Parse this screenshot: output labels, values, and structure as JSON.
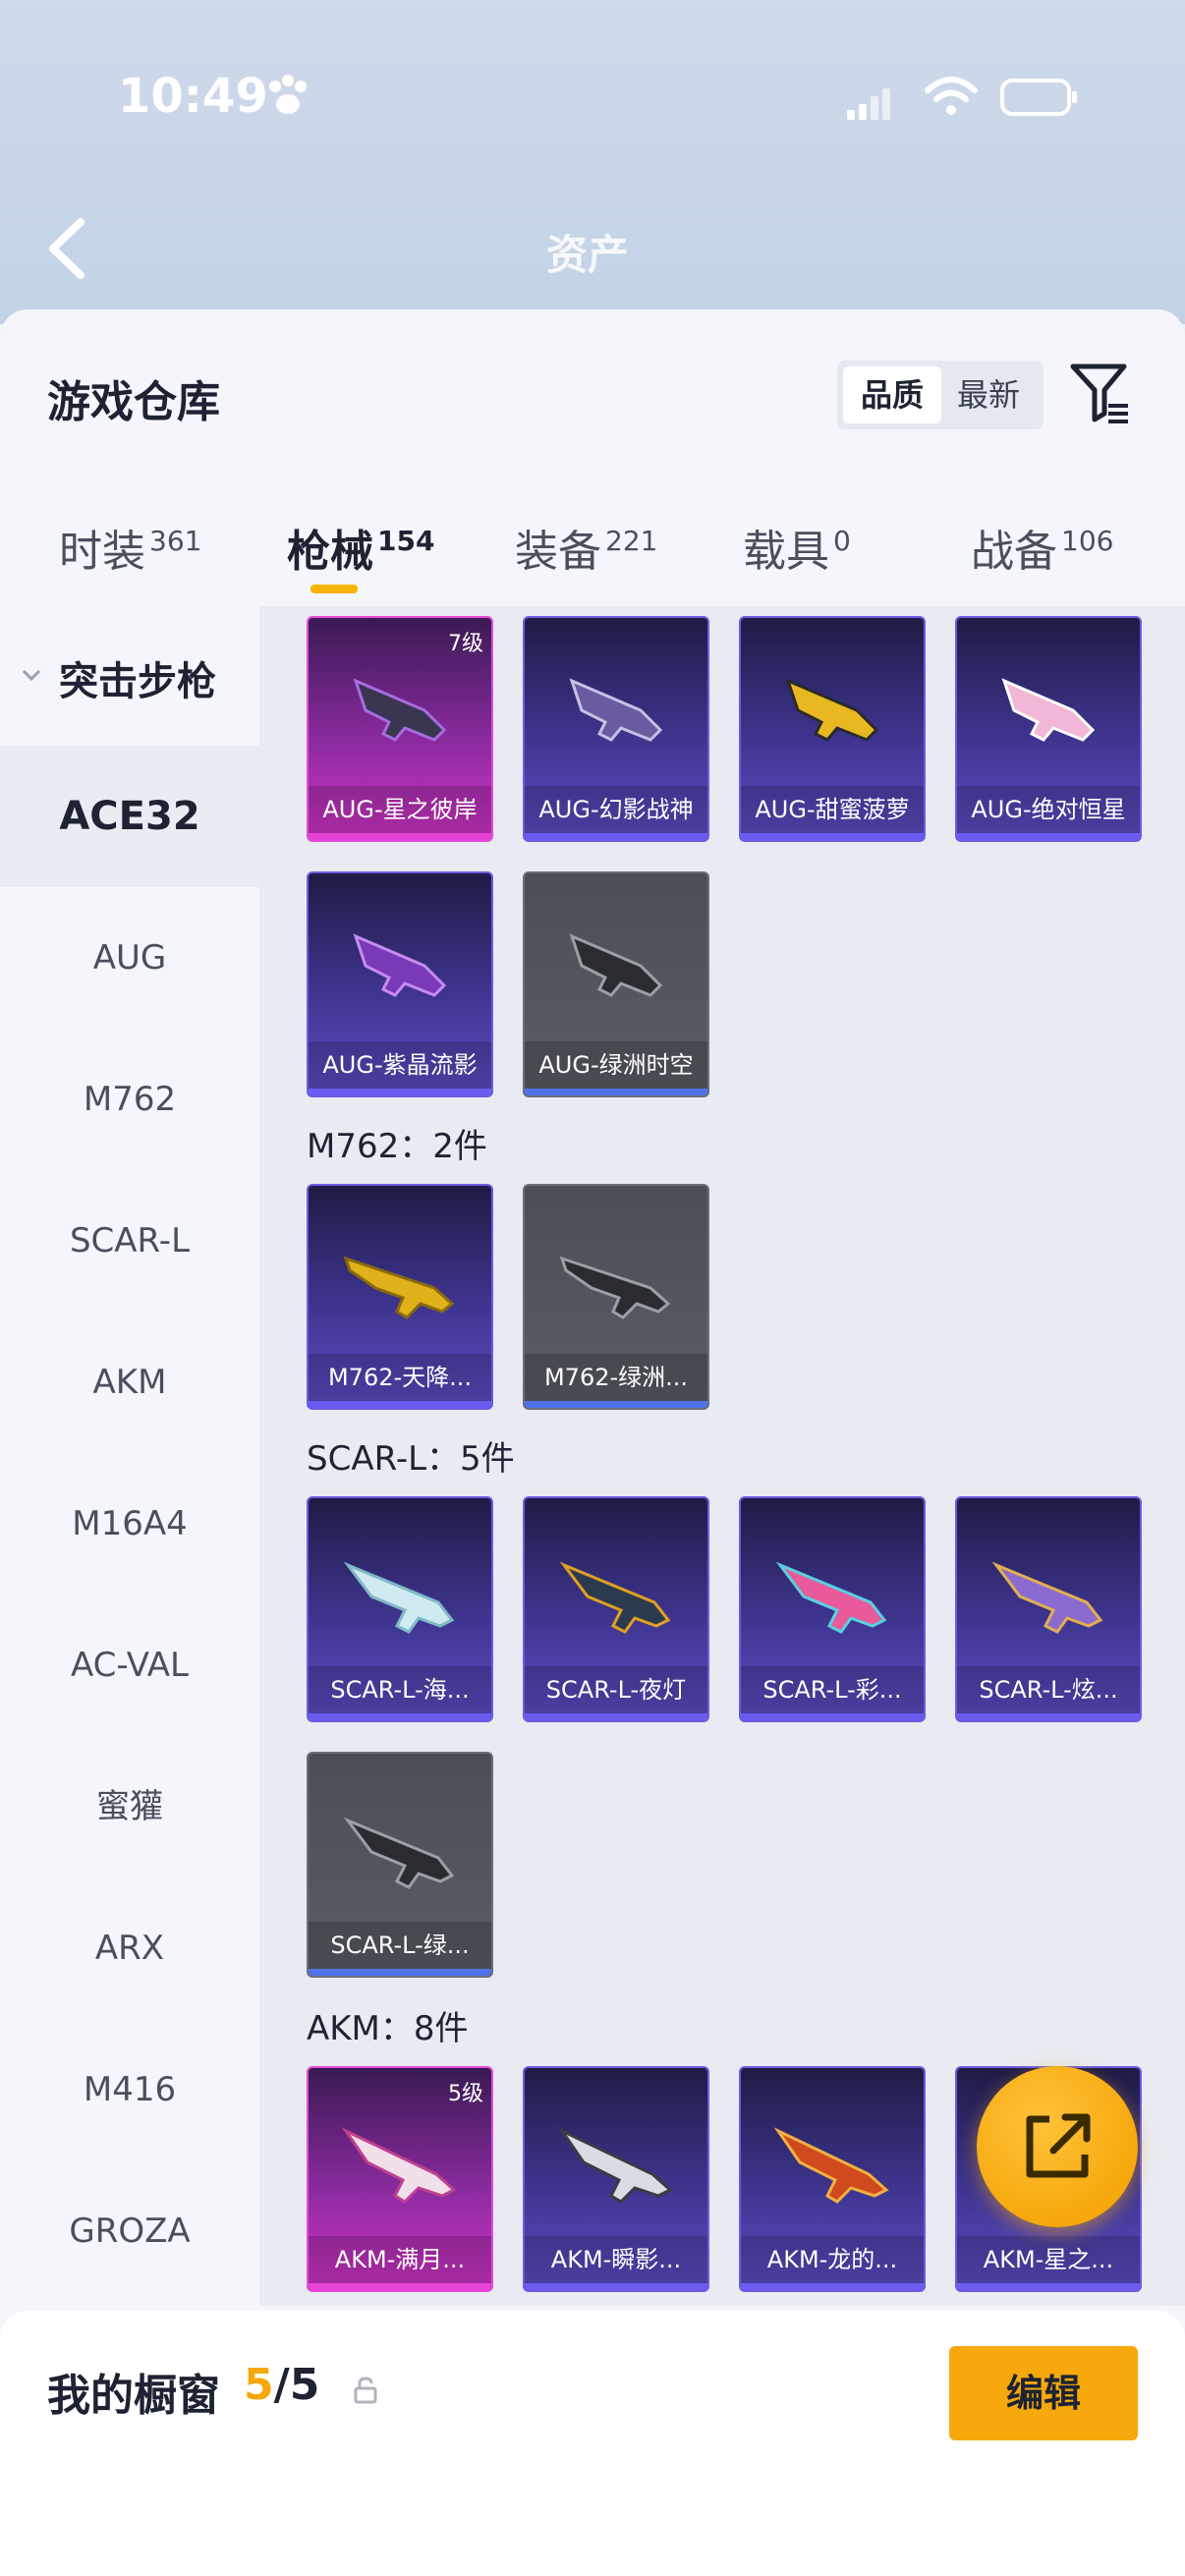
{
  "status_bar": {
    "time": "10:49"
  },
  "header": {
    "back_label": "",
    "title": "资产"
  },
  "warehouse": {
    "title": "游戏仓库",
    "sort_options": [
      "品质",
      "最新"
    ]
  },
  "tabs": [
    {
      "label": "时装",
      "count": "361"
    },
    {
      "label": "枪械",
      "count": "154"
    },
    {
      "label": "装备",
      "count": "221"
    },
    {
      "label": "载具",
      "count": "0"
    },
    {
      "label": "战备",
      "count": "106"
    }
  ],
  "sidebar": {
    "category": "突击步枪",
    "items": [
      "ACE32",
      "AUG",
      "M762",
      "SCAR-L",
      "AKM",
      "M16A4",
      "AC-VAL",
      "蜜獾",
      "ARX",
      "M416",
      "GROZA"
    ]
  },
  "groups": {
    "aug": {
      "cards": [
        {
          "name": "AUG-星之彼岸",
          "level": "7级"
        },
        {
          "name": "AUG-幻影战神"
        },
        {
          "name": "AUG-甜蜜菠萝"
        },
        {
          "name": "AUG-绝对恒星"
        },
        {
          "name": "AUG-紫晶流影"
        },
        {
          "name": "AUG-绿洲时空"
        }
      ]
    },
    "m762": {
      "title": "M762：2件",
      "cards": [
        {
          "name": "M762-天降..."
        },
        {
          "name": "M762-绿洲..."
        }
      ]
    },
    "scarl": {
      "title": "SCAR-L：5件",
      "cards": [
        {
          "name": "SCAR-L-海..."
        },
        {
          "name": "SCAR-L-夜灯"
        },
        {
          "name": "SCAR-L-彩..."
        },
        {
          "name": "SCAR-L-炫..."
        },
        {
          "name": "SCAR-L-绿..."
        }
      ]
    },
    "akm": {
      "title": "AKM：8件",
      "cards": [
        {
          "name": "AKM-满月...",
          "level": "5级"
        },
        {
          "name": "AKM-瞬影..."
        },
        {
          "name": "AKM-龙的..."
        },
        {
          "name": "AKM-星之..."
        }
      ]
    }
  },
  "showcase": {
    "label": "我的橱窗",
    "current": "5",
    "separator_total": "/5",
    "edit_label": "编辑"
  },
  "colors": {
    "accent": "#f6a80c",
    "rare_purple": "#5a4fc6",
    "legend_pink": "#d535c9"
  }
}
